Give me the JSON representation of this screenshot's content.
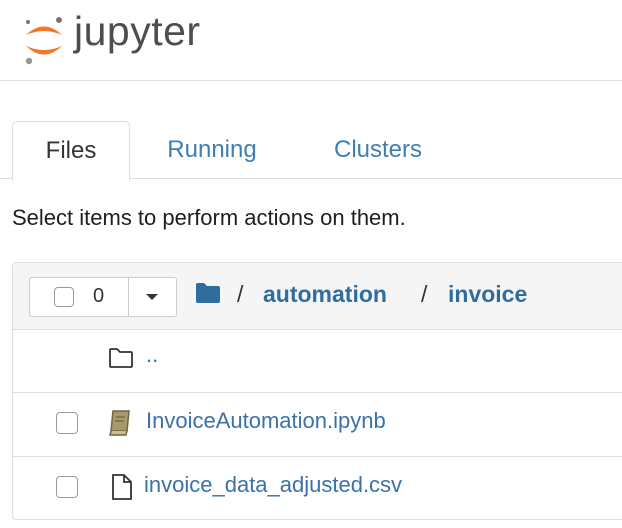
{
  "header": {
    "logo_text": "jupyter"
  },
  "tabs": [
    {
      "label": "Files",
      "active": true
    },
    {
      "label": "Running",
      "active": false
    },
    {
      "label": "Clusters",
      "active": false
    }
  ],
  "instruction": "Select items to perform actions on them.",
  "toolbar": {
    "selected_count": "0"
  },
  "breadcrumb": {
    "separator": "/",
    "items": [
      "automation",
      "invoice"
    ]
  },
  "files": [
    {
      "name": "..",
      "type": "parent-folder"
    },
    {
      "name": "InvoiceAutomation.ipynb",
      "type": "notebook"
    },
    {
      "name": "invoice_data_adjusted.csv",
      "type": "file"
    }
  ],
  "colors": {
    "link": "#3a72a8",
    "crumb": "#2f6d9e",
    "logo_orange": "#f37726",
    "notebook_icon": "#8a7e53"
  }
}
